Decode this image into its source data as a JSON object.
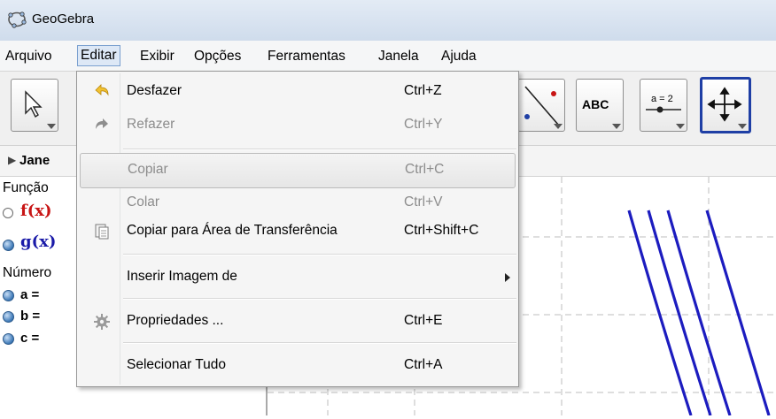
{
  "window": {
    "title": "GeoGebra",
    "icon": "geogebra-icon"
  },
  "menubar": [
    {
      "label": "Arquivo"
    },
    {
      "label": "Editar",
      "active": true
    },
    {
      "label": "Exibir"
    },
    {
      "label": "Opções"
    },
    {
      "label": "Ferramentas"
    },
    {
      "label": "Janela"
    },
    {
      "label": "Ajuda"
    }
  ],
  "toolbar": {
    "tools": [
      {
        "name": "move-tool",
        "icon": "arrow-cursor-icon"
      },
      {
        "name": "line-tool",
        "icon": "line-through-points-icon"
      },
      {
        "name": "text-tool",
        "icon": "abc-text-icon",
        "text": "ABC"
      },
      {
        "name": "slider-tool",
        "icon": "slider-icon",
        "text": "a = 2"
      },
      {
        "name": "move-graphics-tool",
        "icon": "move-cross-arrows-icon",
        "selected": true
      }
    ]
  },
  "algebra": {
    "header_label": "Jane",
    "funcao_label": "Função",
    "f_label": "f(x)",
    "g_label": "g(x)",
    "numero_label": "Número",
    "a_label": "a =",
    "b_label": "b =",
    "c_label": "c ="
  },
  "edit_menu": {
    "items": [
      {
        "label": "Desfazer",
        "shortcut": "Ctrl+Z",
        "icon": "undo-icon",
        "enabled": true
      },
      {
        "label": "Refazer",
        "shortcut": "Ctrl+Y",
        "icon": "redo-icon",
        "enabled": false
      },
      {
        "label": "Copiar",
        "shortcut": "Ctrl+C",
        "enabled": false,
        "hovered": true
      },
      {
        "label": "Colar",
        "shortcut": "Ctrl+V",
        "enabled": false
      },
      {
        "label": "Copiar para Área de Transferência",
        "shortcut": "Ctrl+Shift+C",
        "icon": "clipboard-icon",
        "enabled": true
      },
      {
        "label": "Inserir Imagem de",
        "submenu": true,
        "enabled": true
      },
      {
        "label": "Propriedades ...",
        "shortcut": "Ctrl+E",
        "icon": "gear-icon",
        "enabled": true
      },
      {
        "label": "Selecionar Tudo",
        "shortcut": "Ctrl+A",
        "enabled": true
      }
    ]
  },
  "colors": {
    "graph_curve": "#1c1cbf",
    "grid": "#bdbdbd",
    "f_color": "#c81515",
    "g_color": "#1a1aa8",
    "selected_tool_border": "#1f3fa5"
  }
}
